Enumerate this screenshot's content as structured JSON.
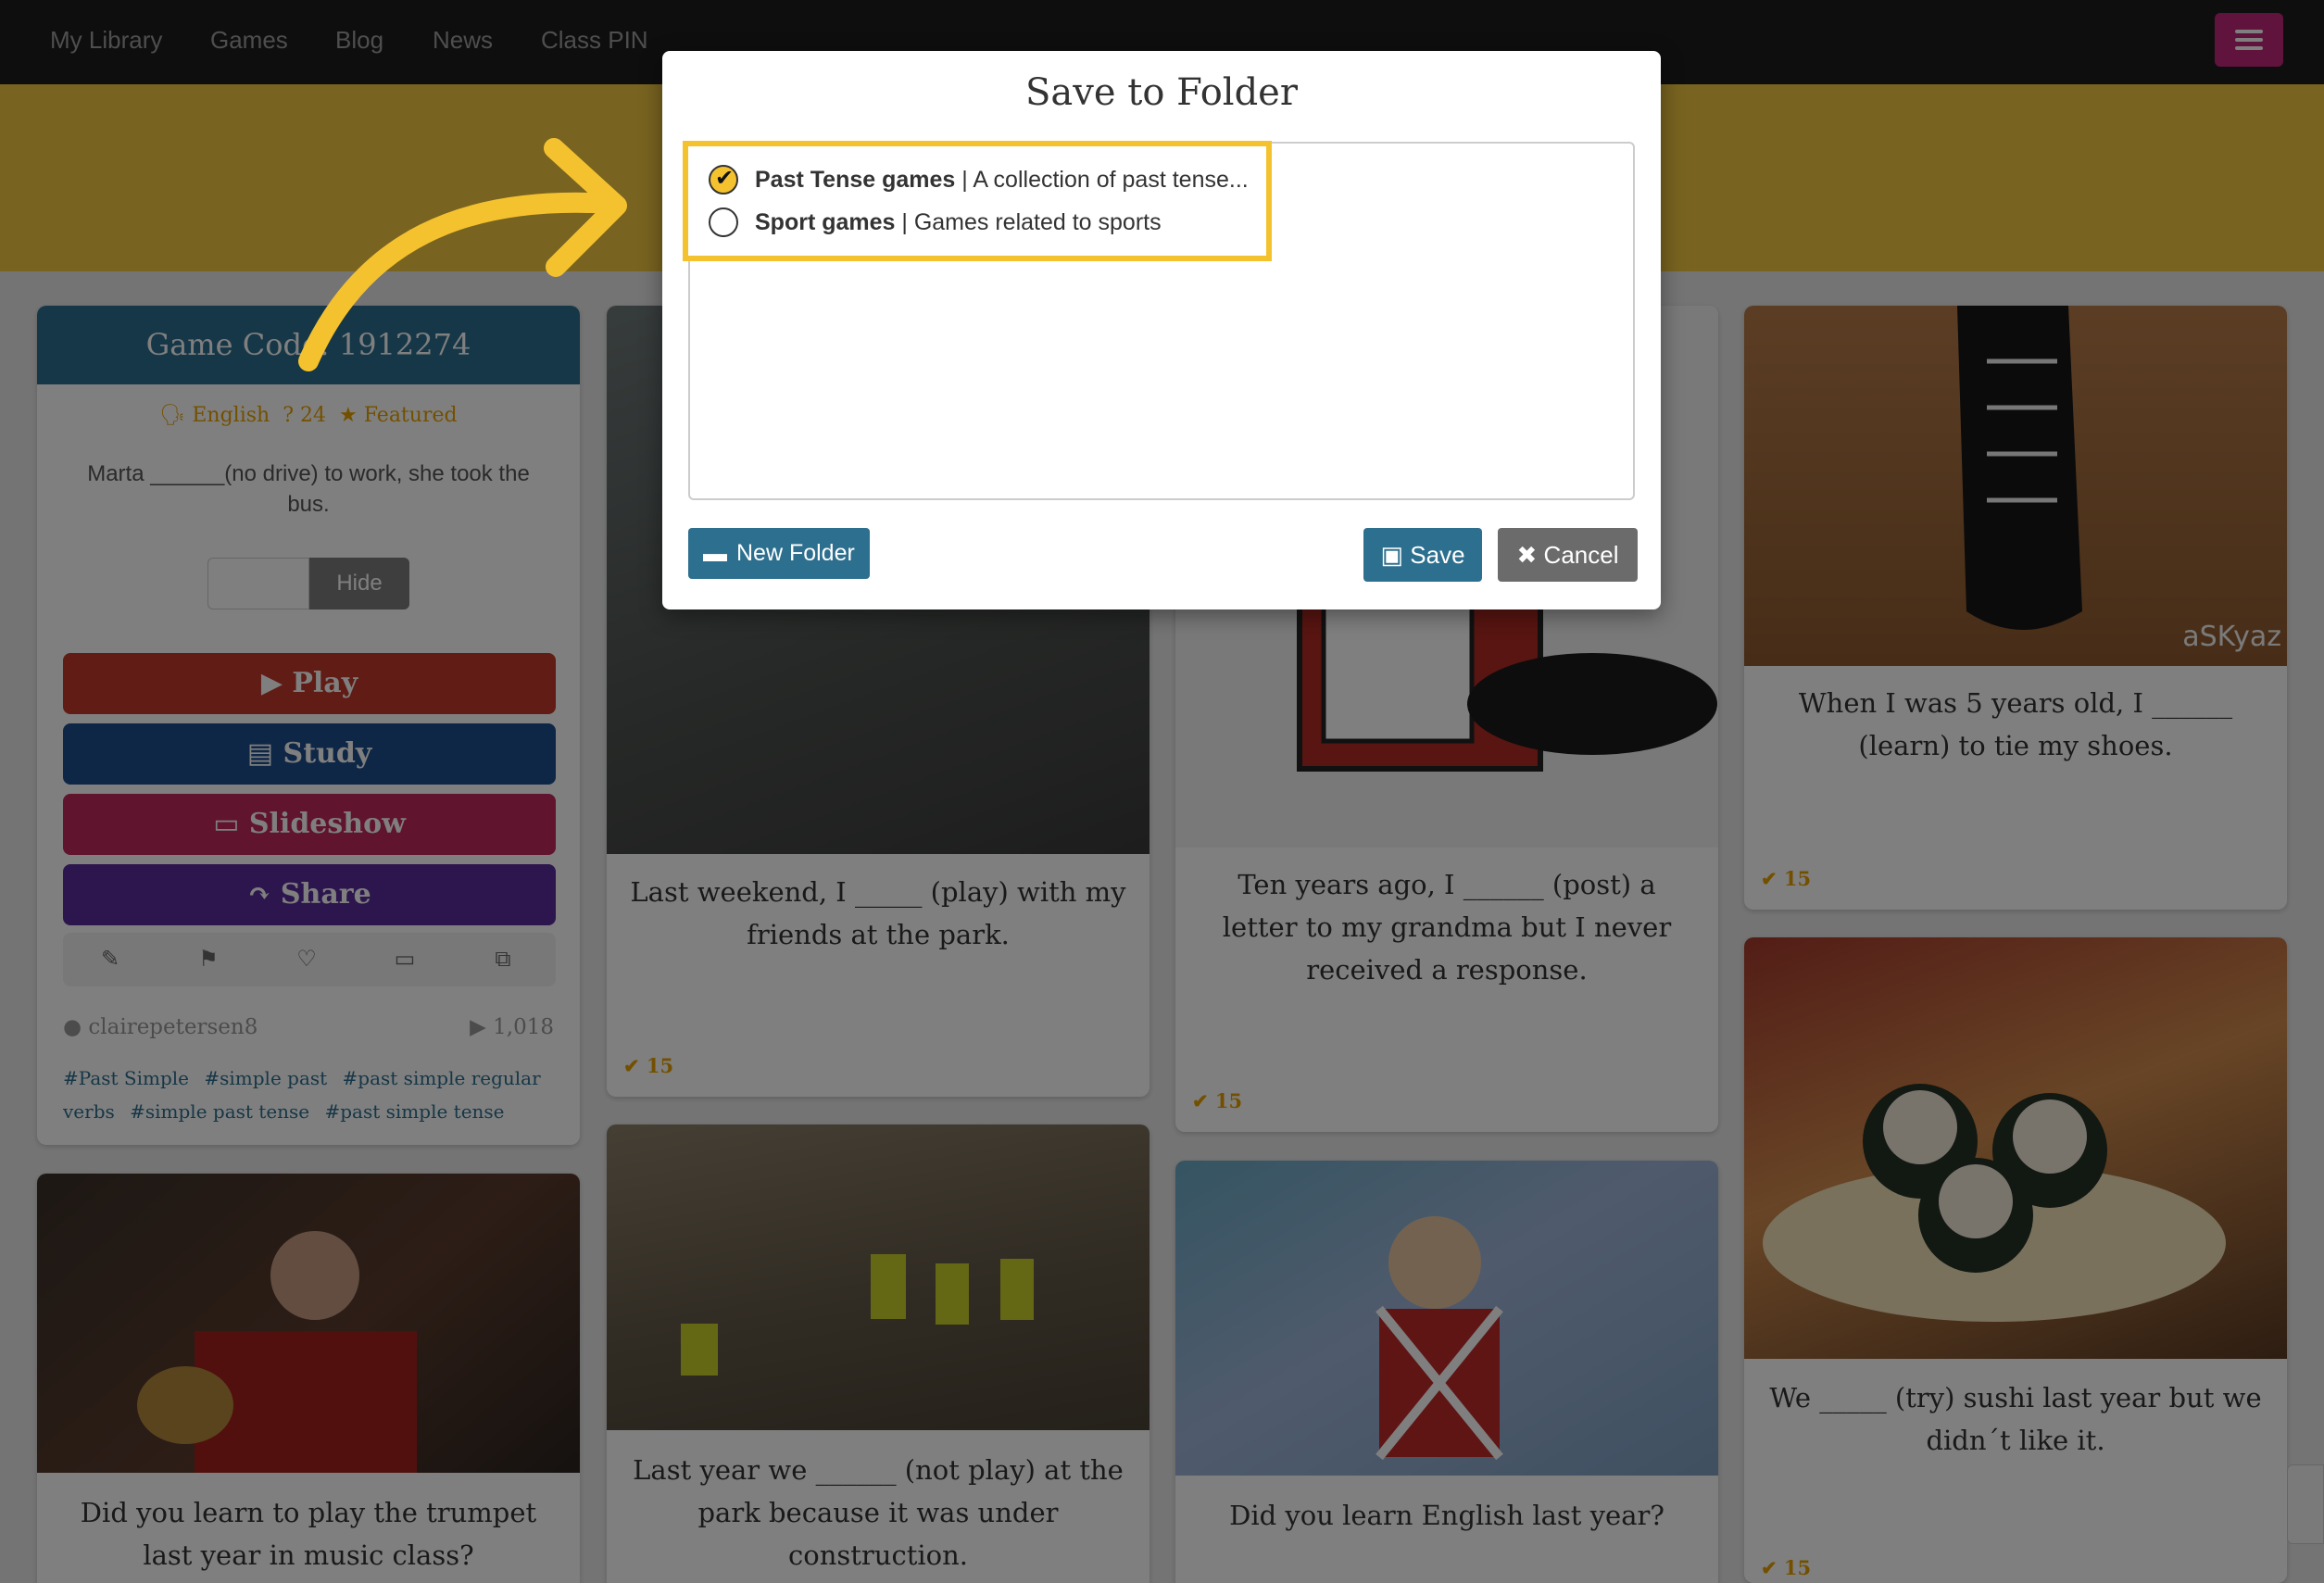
{
  "nav": {
    "links": [
      "My Library",
      "Games",
      "Blog",
      "News",
      "Class PIN"
    ]
  },
  "game_card": {
    "title": "Game Code: 1912274",
    "language": "English",
    "question_count": "24",
    "featured": "Featured",
    "question": "Marta ______(no drive) to work, she took the bus.",
    "hide_label": "Hide",
    "play_label": "Play",
    "study_label": "Study",
    "slideshow_label": "Slideshow",
    "share_label": "Share",
    "user": "clairepetersen8",
    "plays": "1,018",
    "tags": [
      "#Past Simple",
      "#simple past",
      "#past simple regular verbs",
      "#simple past tense",
      "#past simple tense"
    ]
  },
  "cards": [
    {
      "text": "Last weekend, I _____ (play) with my friends at the park.",
      "count": "15"
    },
    {
      "text": "Ten years ago, I ______ (post) a letter to my grandma but I never received a response.",
      "count": "15"
    },
    {
      "text": "When I was 5 years old, I ______ (learn) to tie my shoes.",
      "count": "15",
      "watermark": "aSKyaz"
    },
    {
      "text": "Did you learn to play the trumpet last year in music class?"
    },
    {
      "text": "Last year we ______ (not play) at the park because it was under construction."
    },
    {
      "text": "Did you learn English last year?"
    },
    {
      "text": "We _____ (try) sushi last year but we didn´t like it.",
      "count": "15"
    }
  ],
  "modal": {
    "title": "Save to Folder",
    "folders": [
      {
        "name": "Past Tense games",
        "desc": " | A collection of past tense...",
        "checked": true
      },
      {
        "name": "Sport games",
        "desc": " | Games related to sports",
        "checked": false
      }
    ],
    "new_folder_label": "New Folder",
    "save_label": "Save",
    "cancel_label": "Cancel"
  },
  "colors": {
    "accent": "#2d6f8e",
    "highlight": "#f5c22f",
    "banner": "#f0c640",
    "play": "#c0392b",
    "study": "#1f4e8c",
    "slideshow": "#c0295a",
    "share": "#5b2d9c"
  }
}
